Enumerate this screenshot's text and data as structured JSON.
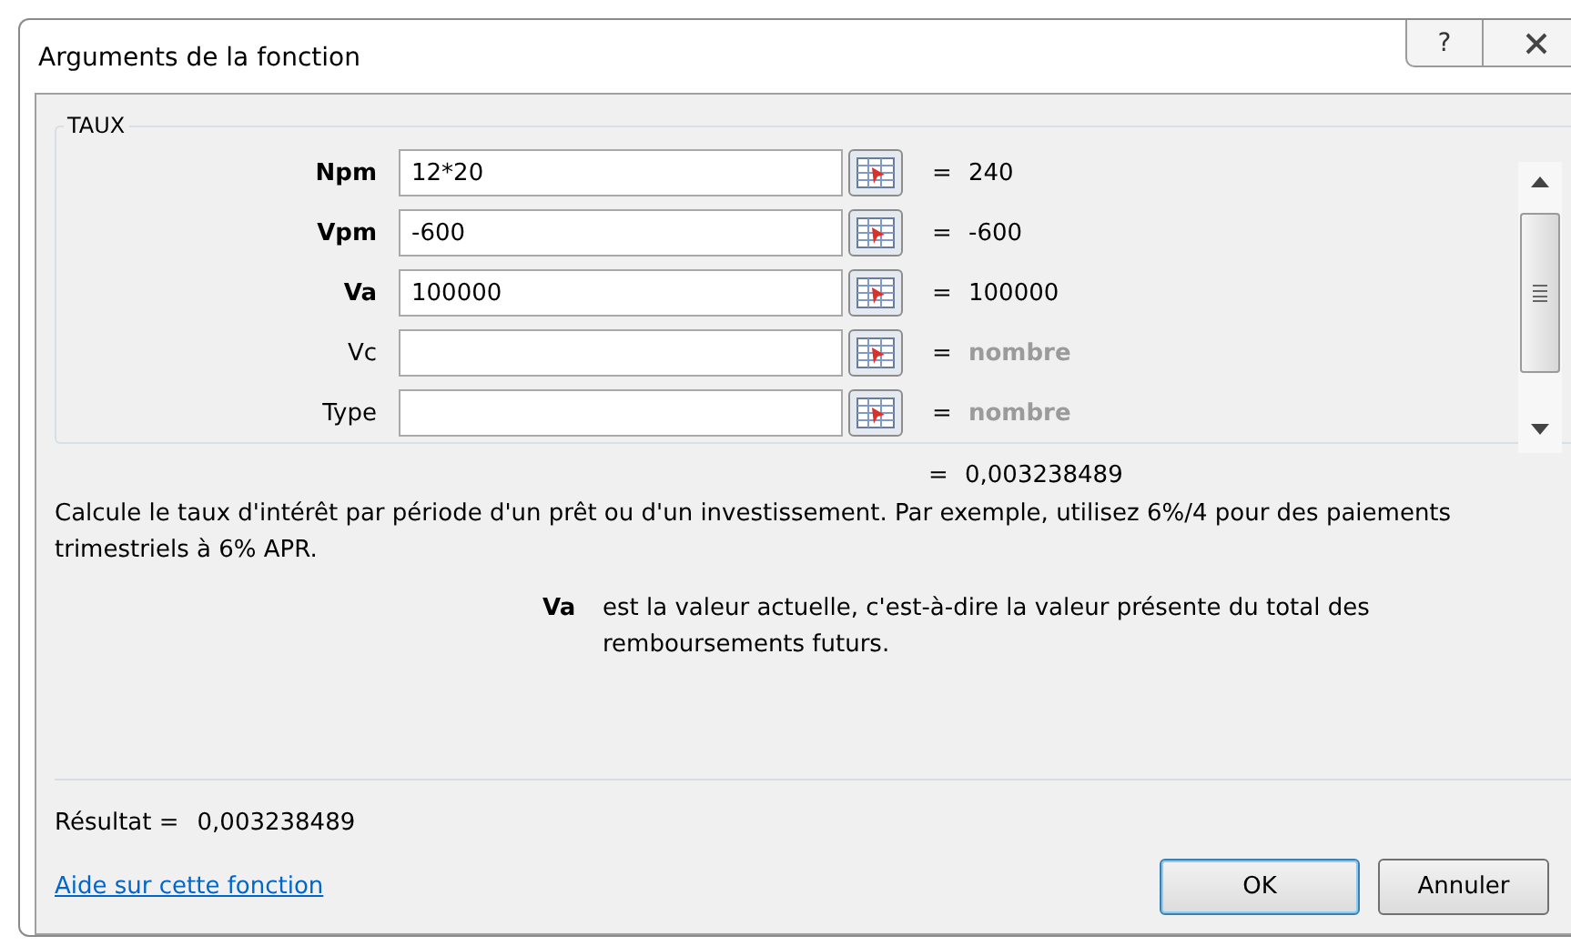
{
  "window": {
    "title": "Arguments de la fonction",
    "help_button": "?"
  },
  "group": {
    "title": "TAUX"
  },
  "arguments": [
    {
      "name": "Npm",
      "required": true,
      "value": "12*20",
      "equals": "=",
      "result": "240",
      "result_is_hint": false
    },
    {
      "name": "Vpm",
      "required": true,
      "value": "-600",
      "equals": "=",
      "result": "-600",
      "result_is_hint": false
    },
    {
      "name": "Va",
      "required": true,
      "value": "100000",
      "equals": "=",
      "result": "100000",
      "result_is_hint": false
    },
    {
      "name": "Vc",
      "required": false,
      "equals": "=",
      "result": "nombre",
      "result_is_hint": true
    },
    {
      "name": "Type",
      "required": false,
      "equals": "=",
      "result": "nombre",
      "result_is_hint": true
    }
  ],
  "formula_result": {
    "equals": "=",
    "value": "0,003238489"
  },
  "description": "Calcule le taux d'intérêt par période d'un prêt ou d'un investissement. Par exemple, utilisez 6%/4 pour des paiements trimestriels à 6% APR.",
  "argument_help": {
    "name": "Va",
    "text": "est la valeur actuelle, c'est-à-dire la valeur présente du total des remboursements futurs."
  },
  "result": {
    "label": "Résultat =",
    "value": "0,003238489"
  },
  "help_link": "Aide sur cette fonction",
  "buttons": [
    {
      "label": "OK",
      "default": true
    },
    {
      "label": "Annuler",
      "default": false
    }
  ]
}
